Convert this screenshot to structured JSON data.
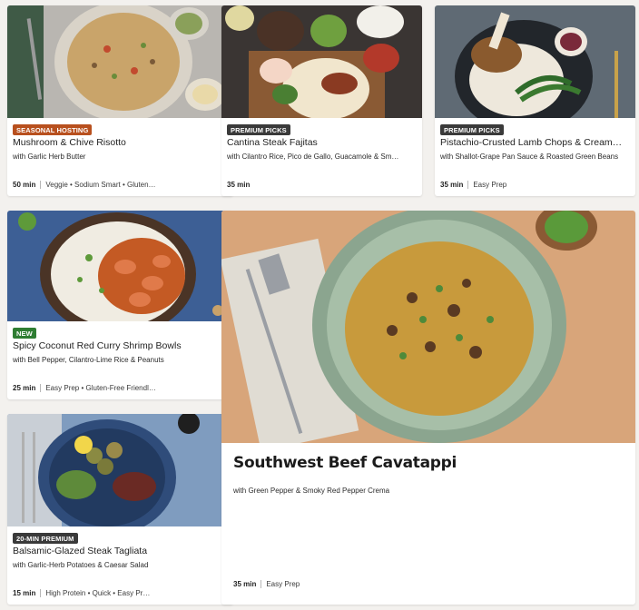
{
  "colors": {
    "badge_seasonal": "#b8501e",
    "badge_premium": "#3a3a3a",
    "badge_new": "#2e7d32"
  },
  "recipes": [
    {
      "badge": "SEASONAL HOSTING",
      "title": "Mushroom & Chive Risotto",
      "subtitle": "with Garlic Herb Butter",
      "time": "50 min",
      "tags": "Veggie • Sodium Smart • Gluten…"
    },
    {
      "badge": "PREMIUM PICKS",
      "title": "Cantina Steak Fajitas",
      "subtitle": "with Cilantro Rice, Pico de Gallo, Guacamole & Sm…",
      "time": "35 min",
      "tags": ""
    },
    {
      "badge": "PREMIUM PICKS",
      "title": "Pistachio-Crusted Lamb Chops & Cream…",
      "subtitle": "with Shallot-Grape Pan Sauce & Roasted Green Beans",
      "time": "35 min",
      "tags": "Easy Prep"
    },
    {
      "badge": "NEW",
      "title": "Spicy Coconut Red Curry Shrimp Bowls",
      "subtitle": "with Bell Pepper, Cilantro-Lime Rice & Peanuts",
      "time": "25 min",
      "tags": "Easy Prep • Gluten-Free Friendl…"
    },
    {
      "badge": "20-MIN PREMIUM",
      "title": "Balsamic-Glazed Steak Tagliata",
      "subtitle": "with Garlic-Herb Potatoes & Caesar Salad",
      "time": "15 min",
      "tags": "High Protein • Quick • Easy Pr…"
    }
  ],
  "featured": {
    "title": "Southwest Beef Cavatappi",
    "subtitle": "with Green Pepper & Smoky Red Pepper Crema",
    "time": "35 min",
    "tags": "Easy Prep"
  }
}
